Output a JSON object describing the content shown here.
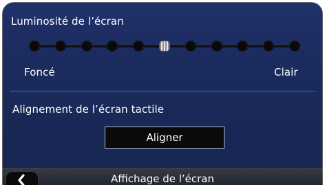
{
  "brightness": {
    "title": "Luminosité de l’écran",
    "min_label": "Foncé",
    "max_label": "Clair",
    "steps": 11,
    "selected_step": 5
  },
  "alignment": {
    "title": "Alignement de l’écran tactile",
    "button_label": "Aligner"
  },
  "bottom_bar": {
    "title": "Affichage de l’écran",
    "back_icon": "chevron-left-icon"
  }
}
